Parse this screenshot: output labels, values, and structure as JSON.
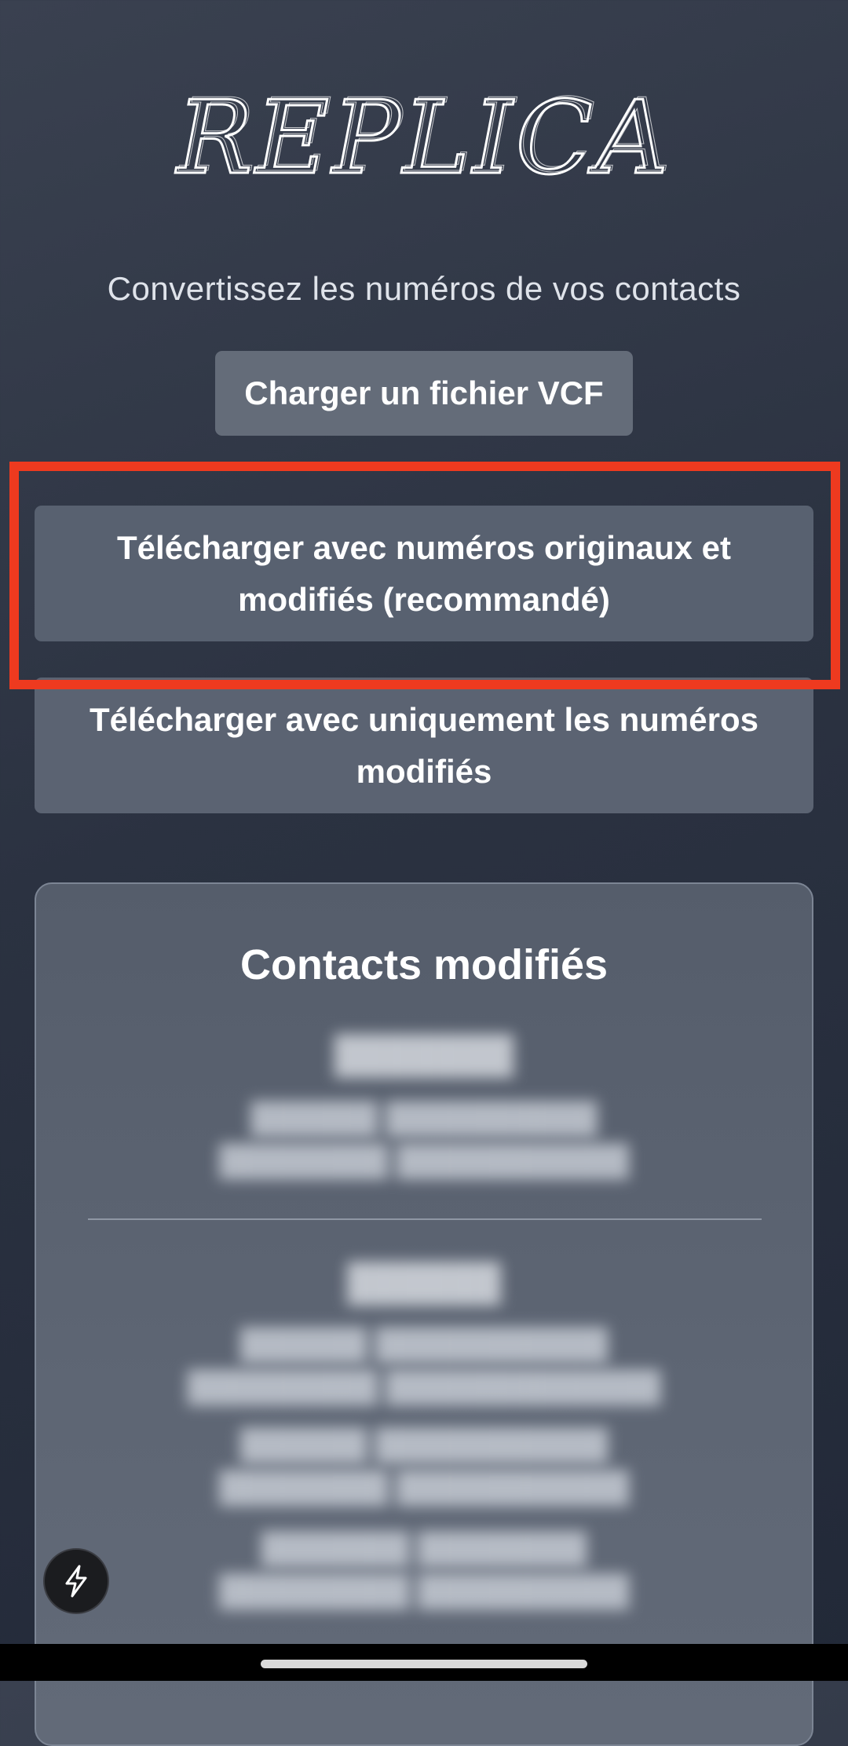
{
  "app": {
    "logo_text": "REPLICA",
    "subtitle": "Convertissez les numéros de vos contacts"
  },
  "actions": {
    "upload_label": "Charger un fichier VCF",
    "download_both_label": "Télécharger avec numéros originaux et modifiés (recommandé)",
    "download_modified_label": "Télécharger avec uniquement les numéros modifiés"
  },
  "contacts_panel": {
    "title": "Contacts modifiés"
  },
  "icons": {
    "fab": "lightning-icon"
  },
  "colors": {
    "highlight": "#ee3a1f",
    "button_bg": "#5f6775",
    "background": "#2b3241"
  }
}
